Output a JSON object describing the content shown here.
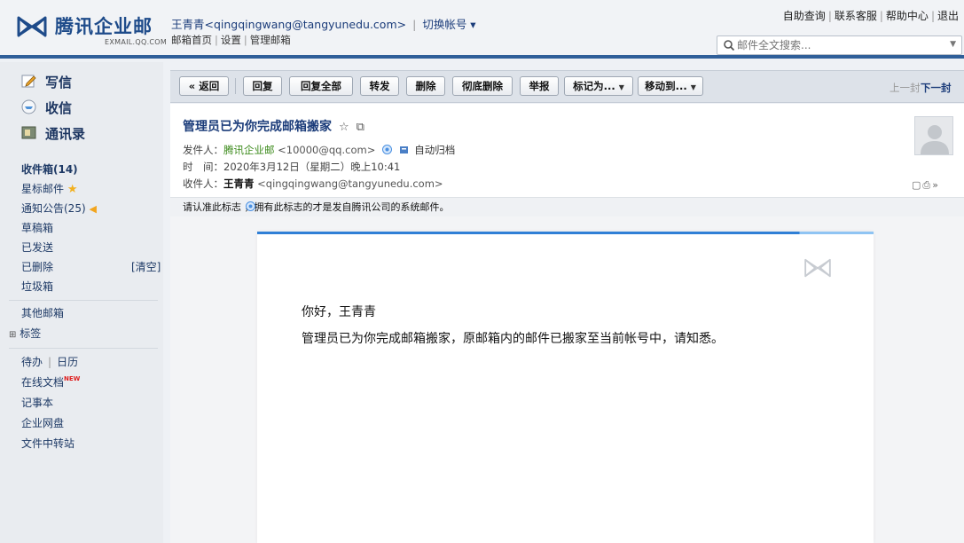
{
  "header": {
    "logo_text": "腾讯企业邮",
    "logo_sub": "EXMAIL.QQ.COM",
    "user_display": "王青青<qingqingwang@tangyunedu.com>",
    "switch_account": "切换帐号 ▾",
    "links": [
      "邮箱首页",
      "设置",
      "管理邮箱"
    ],
    "top_links": [
      "自助查询",
      "联系客服",
      "帮助中心",
      "退出"
    ],
    "search_placeholder": "邮件全文搜索..."
  },
  "sidebar": {
    "compose": "写信",
    "receive": "收信",
    "contacts": "通讯录",
    "folders": {
      "inbox": "收件箱(14)",
      "starred": "星标邮件",
      "notices": "通知公告(25)",
      "drafts": "草稿箱",
      "sent": "已发送",
      "deleted": "已删除",
      "deleted_clear": "[清空]",
      "junk": "垃圾箱"
    },
    "other_mailbox": "其他邮箱",
    "tags": "标签",
    "tools": {
      "todo": "待办",
      "calendar": "日历",
      "docs": "在线文档",
      "docs_badge": "NEW",
      "notes": "记事本",
      "disk": "企业网盘",
      "transfer": "文件中转站"
    }
  },
  "toolbar": {
    "back": "« 返回",
    "reply": "回复",
    "reply_all": "回复全部",
    "forward": "转发",
    "delete": "删除",
    "delete_perm": "彻底删除",
    "report": "举报",
    "mark_as": "标记为...",
    "move_to": "移动到...",
    "prev": "上一封",
    "next": "下一封"
  },
  "mail": {
    "subject": "管理员已为你完成邮箱搬家",
    "from_label": "发件人：",
    "from_name": "腾讯企业邮",
    "from_addr": "<10000@qq.com>",
    "auto_archive": "自动归档",
    "time_label": "时　间：",
    "time_value": "2020年3月12日（星期二）晚上10:41",
    "to_label": "收件人：",
    "to_name": "王青青",
    "to_addr": "<qingqingwang@tangyunedu.com>",
    "notice": "请认准此标志      ，拥有此标志的才是发自腾讯公司的系统邮件。",
    "greeting": "你好，王青青",
    "content": "管理员已为你完成邮箱搬家，原邮箱内的邮件已搬家至当前帐号中，请知悉。"
  },
  "colors": {
    "brand": "#1e4b8a",
    "header_border": "#2f5f99",
    "card_bar": "#2f7fd6",
    "sender_green": "#3b8a1a"
  }
}
